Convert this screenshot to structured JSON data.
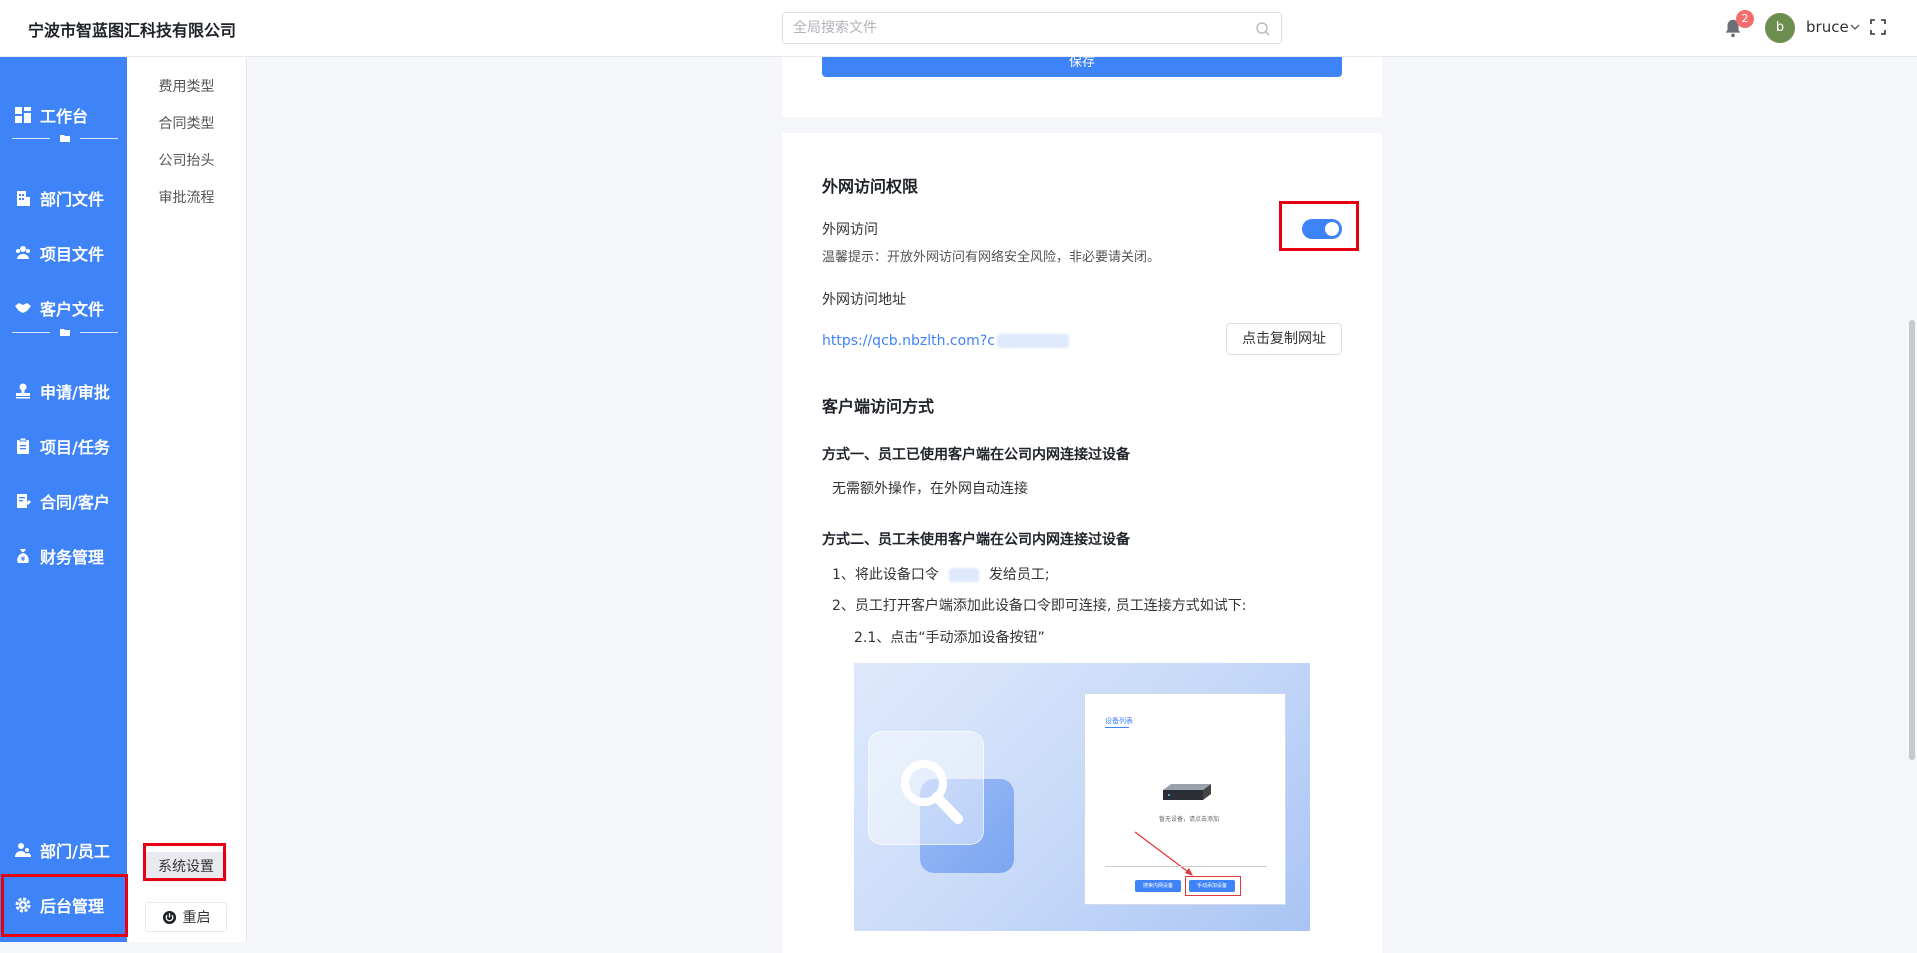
{
  "header": {
    "company": "宁波市智蓝图汇科技有限公司",
    "search_placeholder": "全局搜索文件",
    "notification_count": "2",
    "avatar_letter": "b",
    "username": "bruce"
  },
  "sidebar": {
    "items": [
      {
        "label": "工作台",
        "icon": "dashboard-icon"
      },
      {
        "label": "部门文件",
        "icon": "building-icon"
      },
      {
        "label": "项目文件",
        "icon": "users-icon"
      },
      {
        "label": "客户文件",
        "icon": "handshake-icon"
      },
      {
        "label": "申请/审批",
        "icon": "stamp-icon"
      },
      {
        "label": "项目/任务",
        "icon": "clipboard-icon"
      },
      {
        "label": "合同/客户",
        "icon": "contract-icon"
      },
      {
        "label": "财务管理",
        "icon": "money-bag-icon"
      },
      {
        "label": "部门/员工",
        "icon": "user-group-icon"
      },
      {
        "label": "后台管理",
        "icon": "gear-icon"
      }
    ]
  },
  "subnav": {
    "items": [
      "费用类型",
      "合同类型",
      "公司抬头",
      "审批流程"
    ],
    "system_settings": "系统设置",
    "restart": "重启"
  },
  "content": {
    "save_label": "保存",
    "section_title": "外网访问权限",
    "external_access_label": "外网访问",
    "external_access_enabled": true,
    "tip": "温馨提示：开放外网访问有网络安全风险，非必要请关闭。",
    "address_label": "外网访问地址",
    "url": "https://qcb.nbzlth.com?c",
    "copy_button": "点击复制网址",
    "client_title": "客户端访问方式",
    "method1_title": "方式一、员工已使用客户端在公司内网连接过设备",
    "method1_desc": "无需额外操作，在外网自动连接",
    "method2_title": "方式二、员工未使用客户端在公司内网连接过设备",
    "step1_prefix": "1、将此设备口令",
    "step1_suffix": "发给员工;",
    "step2": "2、员工打开客户端添加此设备口令即可连接, 员工连接方式如试下:",
    "step2_1": "2.1、点击“手动添加设备按钮”",
    "illustration": {
      "tab_label": "设备列表",
      "device_text": "暂无设备，请点击添加",
      "btn1": "搜索内网设备",
      "btn2": "手动添加设备"
    }
  }
}
